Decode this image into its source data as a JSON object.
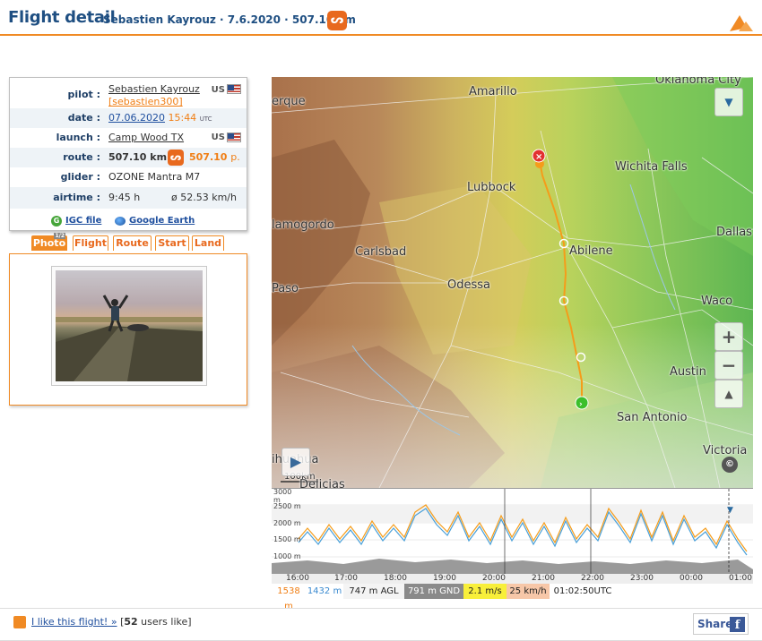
{
  "header": {
    "title": "Flight detail",
    "subtitle": "Sebastien Kayrouz · 7.6.2020 · 507.10 km",
    "type_icon_glyph": "ᔕ"
  },
  "info": {
    "pilot_label": "pilot :",
    "pilot_name": "Sebastien Kayrouz",
    "pilot_user": "[sebastien300]",
    "pilot_country": "US",
    "date_label": "date :",
    "date": "07.06.2020",
    "time": "15:44",
    "time_zone": "UTC",
    "launch_label": "launch :",
    "launch": "Camp Wood TX",
    "launch_country": "US",
    "route_label": "route :",
    "route_km": "507.10 km",
    "route_points": "507.10",
    "route_points_unit": "p.",
    "glider_label": "glider :",
    "glider": "OZONE Mantra M7",
    "airtime_label": "airtime :",
    "airtime": "9:45 h",
    "avg_speed": "ø 52.53 km/h",
    "igc_label": "IGC file",
    "ge_label": "Google Earth"
  },
  "tabs": [
    {
      "label": "Photo",
      "badge": "1/2",
      "active": true
    },
    {
      "label": "Flight",
      "active": false
    },
    {
      "label": "Route",
      "active": false
    },
    {
      "label": "Start",
      "active": false
    },
    {
      "label": "Land",
      "active": false
    }
  ],
  "map": {
    "cities": [
      "Amarillo",
      "Oklahoma City",
      "erque",
      "Lubbock",
      "Wichita Falls",
      "lamogordo",
      "Carlsbad",
      "Abilene",
      "Dallas",
      "Paso",
      "Odessa",
      "Waco",
      "Austin",
      "San Antonio",
      "Victoria",
      "ihuahua",
      "Delicias"
    ],
    "scale_label": "100km",
    "zoom_in": "+",
    "zoom_out": "−",
    "menu_glyph": "▼",
    "compass_glyph": "▲"
  },
  "chart": {
    "y_labels": [
      "3000 m",
      "2500 m",
      "2000 m",
      "1500 m",
      "1000 m"
    ],
    "x_labels": [
      "16:00",
      "17:00",
      "18:00",
      "19:00",
      "20:00",
      "21:00",
      "22:00",
      "23:00",
      "00:00",
      "01:00"
    ]
  },
  "status": {
    "alt_gps": "1538 m",
    "alt_baro": "1432 m",
    "agl": "747 m AGL",
    "gnd": "791 m GND",
    "vario": "2.1 m/s",
    "speed": "25 km/h",
    "time": "01:02:50UTC"
  },
  "footer": {
    "like_text": "I like this flight! »",
    "like_count_pre": "[",
    "like_count": "52",
    "like_count_post": " users like]",
    "share_label": "Share",
    "fb_glyph": "f"
  },
  "colors": {
    "accent": "#f08a24",
    "title_blue": "#1f4f82",
    "track": "#f59c1a"
  }
}
